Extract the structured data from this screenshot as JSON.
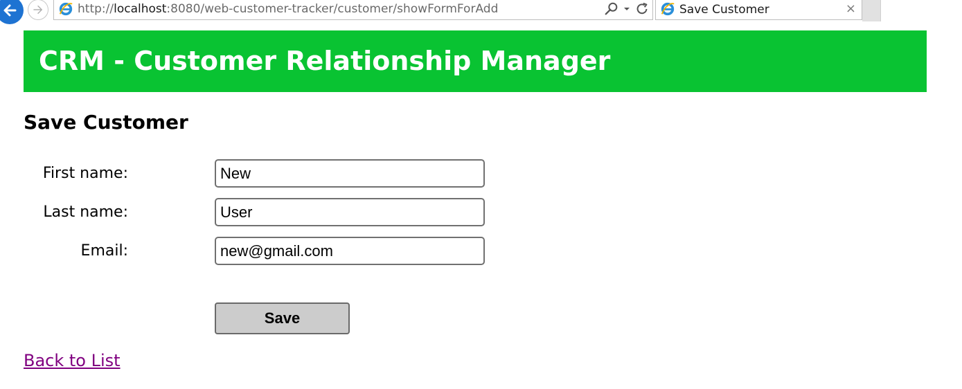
{
  "browser": {
    "back_icon": "arrow-left-icon",
    "forward_icon": "arrow-right-icon",
    "url_prefix": "http://",
    "url_host": "localhost",
    "url_path": ":8080/web-customer-tracker/customer/showFormForAdd",
    "tab_title": "Save Customer",
    "tab_close": "×",
    "accent_color": "#1e73d2"
  },
  "header": {
    "title": "CRM - Customer Relationship Manager",
    "background_color": "#09c332"
  },
  "page": {
    "title": "Save Customer"
  },
  "form": {
    "first_name": {
      "label": "First name:",
      "value": "New"
    },
    "last_name": {
      "label": "Last name:",
      "value": "User"
    },
    "email": {
      "label": "Email:",
      "value": "new@gmail.com"
    },
    "save_label": "Save"
  },
  "footer": {
    "back_link": "Back to List",
    "link_color": "#800080"
  }
}
